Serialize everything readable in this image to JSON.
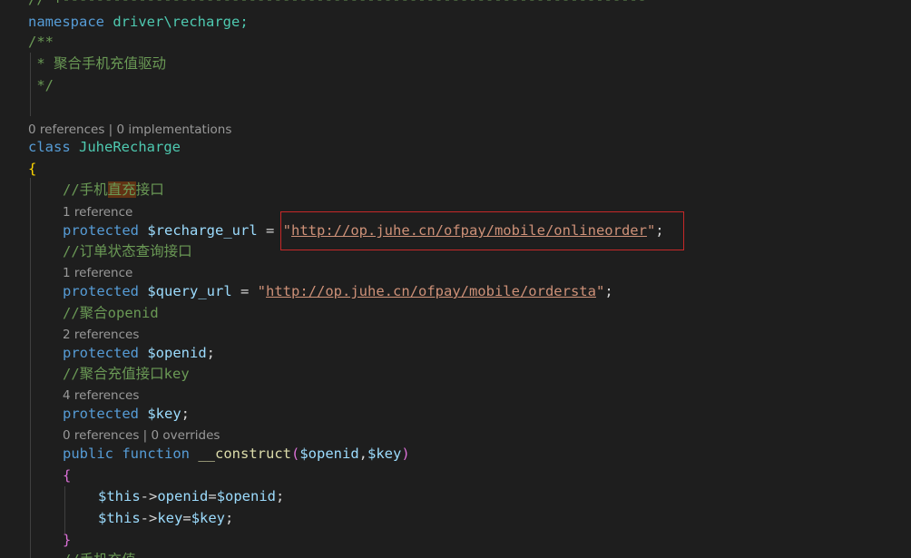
{
  "code": {
    "top_comment": "// +---------------------------------------------------------------------",
    "namespace_kw": "namespace",
    "namespace_name": "driver\\recharge;",
    "doc_open": "/**",
    "doc_line": " * 聚合手机充值驱动",
    "doc_close": " */",
    "class_lens": "0 references | 0 implementations",
    "class_kw": "class",
    "class_name": "JuheRecharge",
    "open_brace": "{",
    "comment1_a": "//手机",
    "comment1_hl": "直充",
    "comment1_b": "接口",
    "lens1": "1 reference",
    "prop1_kw": "protected",
    "prop1_var": "$recharge_url",
    "prop1_eq": " = ",
    "prop1_q1": "\"",
    "prop1_url": "http://op.juhe.cn/ofpay/mobile/onlineorder",
    "prop1_q2": "\"",
    "prop1_semi": ";",
    "comment2": "//订单状态查询接口",
    "lens2": "1 reference",
    "prop2_kw": "protected",
    "prop2_var": "$query_url",
    "prop2_eq": " = ",
    "prop2_q1": "\"",
    "prop2_url": "http://op.juhe.cn/ofpay/mobile/ordersta",
    "prop2_q2": "\"",
    "prop2_semi": ";",
    "comment3": "//聚合openid",
    "lens3": "2 references",
    "prop3_kw": "protected",
    "prop3_var": "$openid",
    "prop3_semi": ";",
    "comment4": "//聚合充值接口key",
    "lens4": "4 references",
    "prop4_kw": "protected",
    "prop4_var": "$key",
    "prop4_semi": ";",
    "lens5": "0 references | 0 overrides",
    "fn_public": "public",
    "fn_kw": "function",
    "fn_name": "__construct",
    "fn_paren_open": "(",
    "fn_arg1": "$openid",
    "fn_comma": ",",
    "fn_arg2": "$key",
    "fn_paren_close": ")",
    "fn_open_brace": "{",
    "body1_this": "$this",
    "body1_arrow": "->",
    "body1_prop": "openid",
    "body1_eq": "=",
    "body1_val": "$openid",
    "body1_semi": ";",
    "body2_this": "$this",
    "body2_arrow": "->",
    "body2_prop": "key",
    "body2_eq": "=",
    "body2_val": "$key",
    "body2_semi": ";",
    "fn_close_brace": "}",
    "comment5": "//手机充值"
  },
  "colors": {
    "background": "#1e1e1e",
    "keyword": "#569cd6",
    "class_name": "#4ec9b0",
    "comment": "#6a9955",
    "string": "#ce9178",
    "variable": "#9cdcfe",
    "function": "#dcdcaa",
    "highlight_box": "#c62828"
  }
}
